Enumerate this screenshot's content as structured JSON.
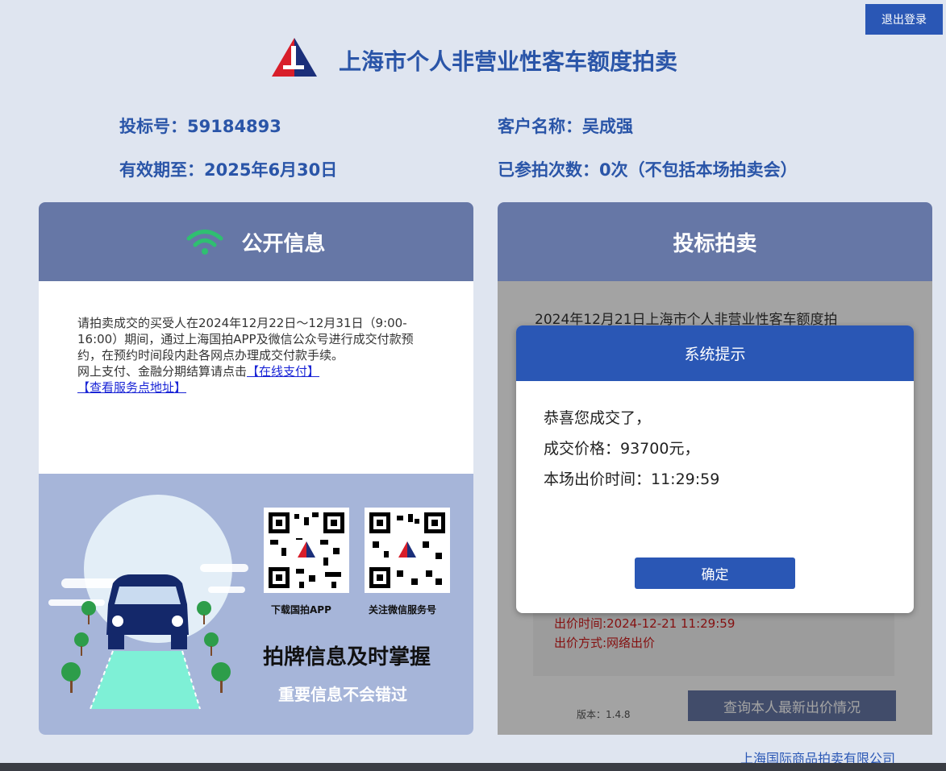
{
  "header": {
    "logout_label": "退出登录",
    "site_title": "上海市个人非营业性客车额度拍卖"
  },
  "user": {
    "bid_no": "投标号：59184893",
    "customer": "客户名称：吴成强",
    "valid_until": "有效期至：2025年6月30日",
    "participations": "已参拍次数：0次（不包括本场拍卖会）"
  },
  "public_info": {
    "title": "公开信息",
    "notice_text": "请拍卖成交的买受人在2024年12月22日～12月31日（9:00-16:00）期间，通过上海国拍APP及微信公众号进行成交付款预约，在预约时间段内赴各网点办理成交付款手续。",
    "pay_prompt": "网上支付、金融分期结算请点击",
    "pay_link": "【在线支付】",
    "service_link": "【查看服务点地址】",
    "qr_app_label": "下载国拍APP",
    "qr_wechat_label": "关注微信服务号",
    "promo_big": "拍牌信息及时掌握",
    "promo_sub": "重要信息不会错过"
  },
  "auction": {
    "title": "投标拍卖",
    "auction_text": "2024年12月21日上海市个人非营业性客车额度拍",
    "bid_time": "出价时间:2024-12-21 11:29:59",
    "bid_method": "出价方式:网络出价",
    "version": "版本：1.4.8",
    "query_button": "查询本人最新出价情况"
  },
  "modal": {
    "title": "系统提示",
    "line1": "恭喜您成交了，",
    "line2": "成交价格：93700元，",
    "line3": "本场出价时间：11:29:59",
    "confirm": "确定"
  },
  "footer": {
    "company": "上海国际商品拍卖有限公司"
  },
  "colors": {
    "brand_blue": "#2a57b5",
    "header_slate": "#6677a6",
    "wifi_green": "#2fbf71",
    "logo_red": "#d81e2a",
    "logo_navy": "#1b2f7a"
  },
  "icons": {
    "logo": "auction-logo-icon",
    "wifi": "wifi-icon",
    "qr": "qr-code-icon"
  }
}
